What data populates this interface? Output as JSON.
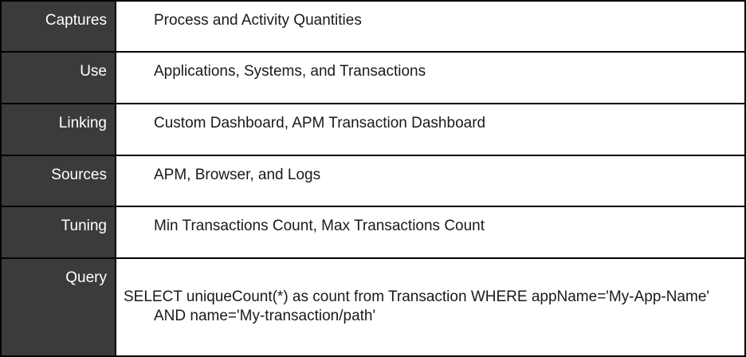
{
  "rows": [
    {
      "label": "Captures",
      "value": "Process and Activity Quantities"
    },
    {
      "label": "Use",
      "value": "Applications, Systems, and Transactions"
    },
    {
      "label": "Linking",
      "value": "Custom Dashboard, APM Transaction Dashboard"
    },
    {
      "label": "Sources",
      "value": "APM, Browser, and Logs"
    },
    {
      "label": "Tuning",
      "value": "Min Transactions Count, Max Transactions Count"
    },
    {
      "label": "Query",
      "value": "SELECT uniqueCount(*) as count from Transaction WHERE appName='My-App-Name' AND name='My-transaction/path'"
    }
  ],
  "colors": {
    "label_background": "#3b3b3b",
    "label_text": "#ffffff",
    "value_text": "#1a1a1a",
    "border": "#000000"
  }
}
